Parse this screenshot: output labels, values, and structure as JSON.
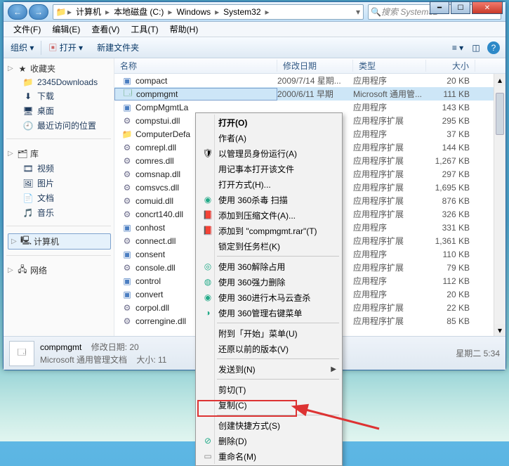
{
  "window": {
    "breadcrumb": [
      "计算机",
      "本地磁盘 (C:)",
      "Windows",
      "System32"
    ],
    "search_placeholder": "搜索 System32",
    "menubar": [
      "文件(F)",
      "编辑(E)",
      "查看(V)",
      "工具(T)",
      "帮助(H)"
    ],
    "toolbar": {
      "organize": "组织 ▾",
      "open": "打开 ▾",
      "new_folder": "新建文件夹"
    },
    "columns": {
      "name": "名称",
      "date": "修改日期",
      "type": "类型",
      "size": "大小"
    }
  },
  "sidebar": {
    "favorites": {
      "label": "收藏夹",
      "items": [
        "2345Downloads",
        "下载",
        "桌面",
        "最近访问的位置"
      ]
    },
    "libraries": {
      "label": "库",
      "items": [
        "视频",
        "图片",
        "文档",
        "音乐"
      ]
    },
    "computer": {
      "label": "计算机"
    },
    "network": {
      "label": "网络"
    }
  },
  "files": [
    {
      "name": "compact",
      "icon": "exe",
      "date": "2009/7/14 星期...",
      "type": "应用程序",
      "size": "20 KB"
    },
    {
      "name": "compmgmt",
      "icon": "msc",
      "date": "2000/6/11 早期",
      "type": "Microsoft 通用管...",
      "size": "111 KB",
      "selected": true
    },
    {
      "name": "CompMgmtLa",
      "icon": "exe",
      "date": "",
      "type": "应用程序",
      "size": "143 KB"
    },
    {
      "name": "compstui.dll",
      "icon": "dll",
      "date": "",
      "type": "应用程序扩展",
      "size": "295 KB"
    },
    {
      "name": "ComputerDefa",
      "icon": "folder",
      "date": "",
      "type": "应用程序",
      "size": "37 KB"
    },
    {
      "name": "comrepl.dll",
      "icon": "dll",
      "date": "",
      "type": "应用程序扩展",
      "size": "144 KB"
    },
    {
      "name": "comres.dll",
      "icon": "dll",
      "date": "",
      "type": "应用程序扩展",
      "size": "1,267 KB"
    },
    {
      "name": "comsnap.dll",
      "icon": "dll",
      "date": "",
      "type": "应用程序扩展",
      "size": "297 KB"
    },
    {
      "name": "comsvcs.dll",
      "icon": "dll",
      "date": "",
      "type": "应用程序扩展",
      "size": "1,695 KB"
    },
    {
      "name": "comuid.dll",
      "icon": "dll",
      "date": "",
      "type": "应用程序扩展",
      "size": "876 KB"
    },
    {
      "name": "concrt140.dll",
      "icon": "dll",
      "date": "",
      "type": "应用程序扩展",
      "size": "326 KB"
    },
    {
      "name": "conhost",
      "icon": "exe",
      "date": "",
      "type": "应用程序",
      "size": "331 KB"
    },
    {
      "name": "connect.dll",
      "icon": "dll",
      "date": "",
      "type": "应用程序扩展",
      "size": "1,361 KB"
    },
    {
      "name": "consent",
      "icon": "exe",
      "date": "",
      "type": "应用程序",
      "size": "110 KB"
    },
    {
      "name": "console.dll",
      "icon": "dll",
      "date": "",
      "type": "应用程序扩展",
      "size": "79 KB"
    },
    {
      "name": "control",
      "icon": "exe",
      "date": "",
      "type": "应用程序",
      "size": "112 KB"
    },
    {
      "name": "convert",
      "icon": "exe",
      "date": "",
      "type": "应用程序",
      "size": "20 KB"
    },
    {
      "name": "corpol.dll",
      "icon": "dll",
      "date": "",
      "type": "应用程序扩展",
      "size": "22 KB"
    },
    {
      "name": "correngine.dll",
      "icon": "dll",
      "date": "",
      "type": "应用程序扩展",
      "size": "85 KB"
    }
  ],
  "context_menu": {
    "open": "打开(O)",
    "author": "作者(A)",
    "run_as_admin": "以管理员身份运行(A)",
    "open_with_notepad": "用记事本打开该文件",
    "open_with": "打开方式(H)...",
    "scan_360": "使用 360杀毒 扫描",
    "add_to_archive": "添加到压缩文件(A)...",
    "add_to_rar": "添加到 \"compmgmt.rar\"(T)",
    "pin_taskbar": "锁定到任务栏(K)",
    "unlock_360": "使用 360解除占用",
    "force_delete_360": "使用 360强力删除",
    "trojan_scan_360": "使用 360进行木马云查杀",
    "menu_360": "使用 360管理右键菜单",
    "pin_start": "附到「开始」菜单(U)",
    "restore_versions": "还原以前的版本(V)",
    "send_to": "发送到(N)",
    "cut": "剪切(T)",
    "copy": "复制(C)",
    "create_shortcut": "创建快捷方式(S)",
    "delete": "删除(D)",
    "rename": "重命名(M)"
  },
  "statusbar": {
    "filename": "compmgmt",
    "filetype": "Microsoft 通用管理文档",
    "mod_label": "修改日期: 20",
    "size_label": "大小: 11",
    "datetime": "星期二 5:34"
  }
}
